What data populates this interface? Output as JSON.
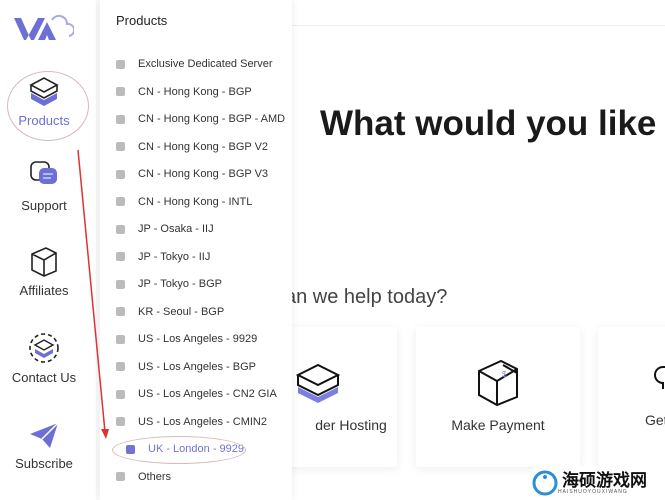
{
  "sidebar": {
    "items": [
      {
        "label": "Products"
      },
      {
        "label": "Support"
      },
      {
        "label": "Affiliates"
      },
      {
        "label": "Contact Us"
      },
      {
        "label": "Subscribe"
      }
    ]
  },
  "panel": {
    "title": "Products",
    "items": [
      {
        "label": "Exclusive Dedicated Server"
      },
      {
        "label": "CN - Hong Kong - BGP"
      },
      {
        "label": "CN - Hong Kong - BGP - AMD"
      },
      {
        "label": "CN - Hong Kong - BGP V2"
      },
      {
        "label": "CN - Hong Kong - BGP V3"
      },
      {
        "label": "CN - Hong Kong - INTL"
      },
      {
        "label": "JP - Osaka - IIJ"
      },
      {
        "label": "JP - Tokyo - IIJ"
      },
      {
        "label": "JP - Tokyo - BGP"
      },
      {
        "label": "KR - Seoul - BGP"
      },
      {
        "label": "US - Los Angeles - 9929"
      },
      {
        "label": "US - Los Angeles - BGP"
      },
      {
        "label": "US - Los Angeles - CN2 GIA"
      },
      {
        "label": "US - Los Angeles - CMIN2"
      },
      {
        "label": "UK - London - 9929"
      },
      {
        "label": "Others"
      }
    ],
    "selected": "UK - London - 9929"
  },
  "main": {
    "title": "What would you like t",
    "subtitle": "an we help today?",
    "cards": [
      {
        "label": "der Hosting"
      },
      {
        "label": "Make Payment"
      },
      {
        "label": "Get"
      }
    ]
  },
  "watermark": {
    "text": "海硕游戏网",
    "sub": "HAISHUOYOUXIWANG"
  },
  "colors": {
    "accent": "#6c6fd6",
    "annotation": "#d33"
  }
}
